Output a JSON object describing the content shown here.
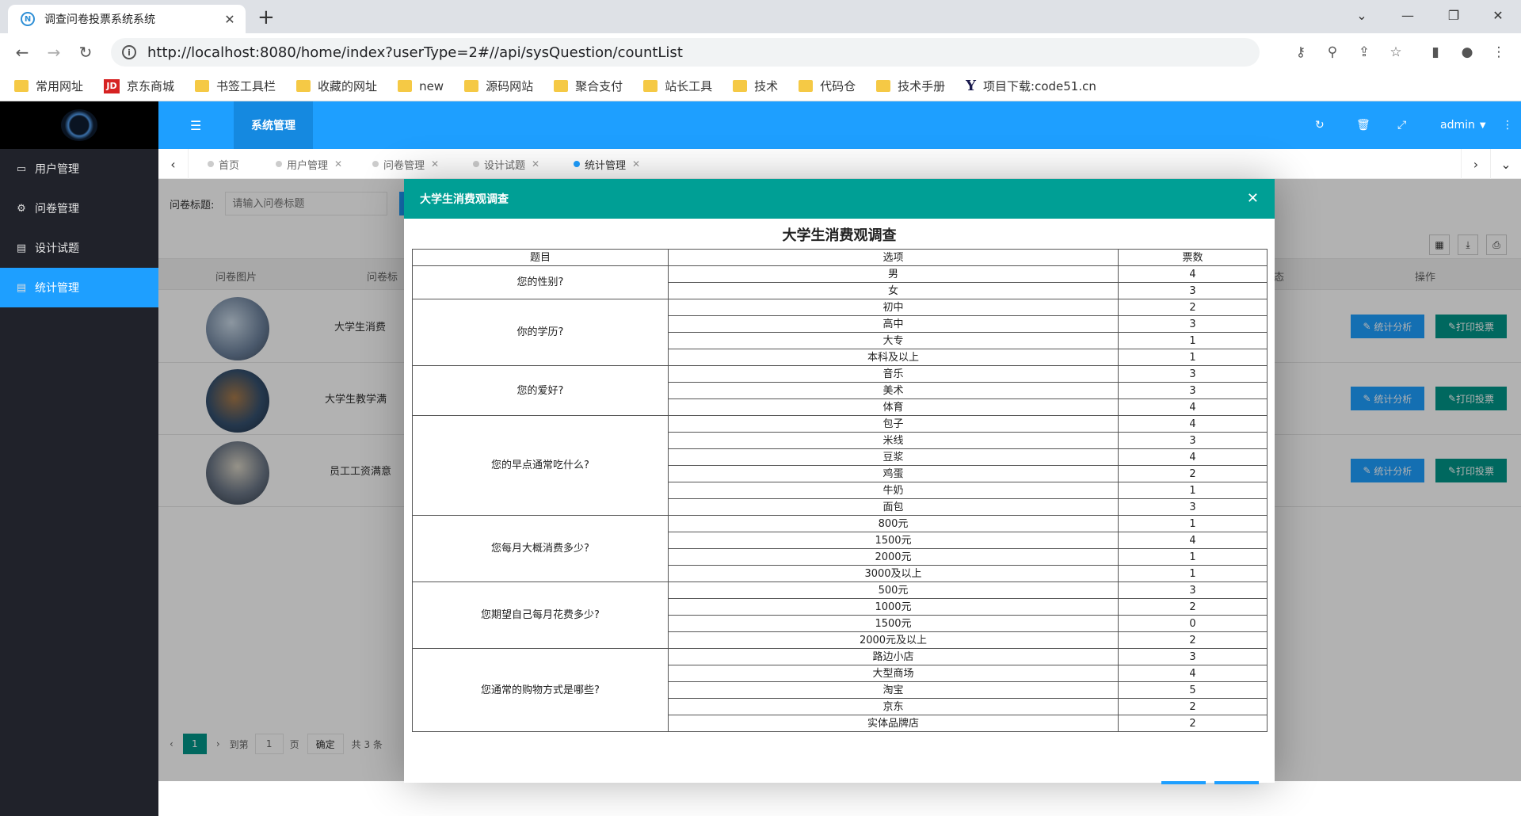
{
  "browser": {
    "tab_title": "调查问卷投票系统系统",
    "url": "http://localhost:8080/home/index?userType=2#//api/sysQuestion/countList",
    "bookmarks": [
      "常用网址",
      "京东商城",
      "书签工具栏",
      "收藏的网址",
      "new",
      "源码网站",
      "聚合支付",
      "站长工具",
      "技术",
      "代码仓",
      "技术手册",
      "项目下载:code51.cn"
    ]
  },
  "app": {
    "topbar": {
      "system_label": "系统管理",
      "user": "admin"
    },
    "sidebar": [
      {
        "label": "用户管理",
        "icon": "window-icon"
      },
      {
        "label": "问卷管理",
        "icon": "gears-icon"
      },
      {
        "label": "设计试题",
        "icon": "document-icon"
      },
      {
        "label": "统计管理",
        "icon": "document-icon",
        "active": true
      }
    ],
    "page_tabs": [
      "首页",
      "用户管理",
      "问卷管理",
      "设计试题",
      "统计管理"
    ],
    "search": {
      "label": "问卷标题:",
      "placeholder": "请输入问卷标题"
    },
    "table": {
      "headers": {
        "image": "问卷图片",
        "title": "问卷标",
        "status": "态",
        "actions": "操作"
      },
      "rows": [
        {
          "title": "大学生消费"
        },
        {
          "title": "大学生教学满"
        },
        {
          "title": "员工工资满意"
        }
      ],
      "stat_button": "统计分析",
      "print_button": "打印投票"
    },
    "pager": {
      "current": "1",
      "goto": "到第",
      "page_input": "1",
      "page": "页",
      "confirm": "确定",
      "total": "共 3 条"
    }
  },
  "modal": {
    "header": "大学生消费观调查",
    "title": "大学生消费观调查",
    "columns": [
      "题目",
      "选项",
      "票数"
    ],
    "questions": [
      {
        "q": "您的性别?",
        "options": [
          [
            "男",
            4
          ],
          [
            "女",
            3
          ]
        ]
      },
      {
        "q": "你的学历?",
        "options": [
          [
            "初中",
            2
          ],
          [
            "高中",
            3
          ],
          [
            "大专",
            1
          ],
          [
            "本科及以上",
            1
          ]
        ]
      },
      {
        "q": "您的爱好?",
        "options": [
          [
            "音乐",
            3
          ],
          [
            "美术",
            3
          ],
          [
            "体育",
            4
          ]
        ]
      },
      {
        "q": "您的早点通常吃什么?",
        "options": [
          [
            "包子",
            4
          ],
          [
            "米线",
            3
          ],
          [
            "豆浆",
            4
          ],
          [
            "鸡蛋",
            2
          ],
          [
            "牛奶",
            1
          ],
          [
            "面包",
            3
          ]
        ]
      },
      {
        "q": "您每月大概消费多少?",
        "options": [
          [
            "800元",
            1
          ],
          [
            "1500元",
            4
          ],
          [
            "2000元",
            1
          ],
          [
            "3000及以上",
            1
          ]
        ]
      },
      {
        "q": "您期望自己每月花费多少?",
        "options": [
          [
            "500元",
            3
          ],
          [
            "1000元",
            2
          ],
          [
            "1500元",
            0
          ],
          [
            "2000元及以上",
            2
          ]
        ]
      },
      {
        "q": "您通常的购物方式是哪些?",
        "options": [
          [
            "路边小店",
            3
          ],
          [
            "大型商场",
            4
          ],
          [
            "淘宝",
            5
          ],
          [
            "京东",
            2
          ],
          [
            "实体品牌店",
            2
          ]
        ]
      }
    ]
  },
  "colors": {
    "primary": "#1e9fff",
    "teal": "#009688",
    "modal_header": "#009f95",
    "sidebar": "#20222a"
  }
}
